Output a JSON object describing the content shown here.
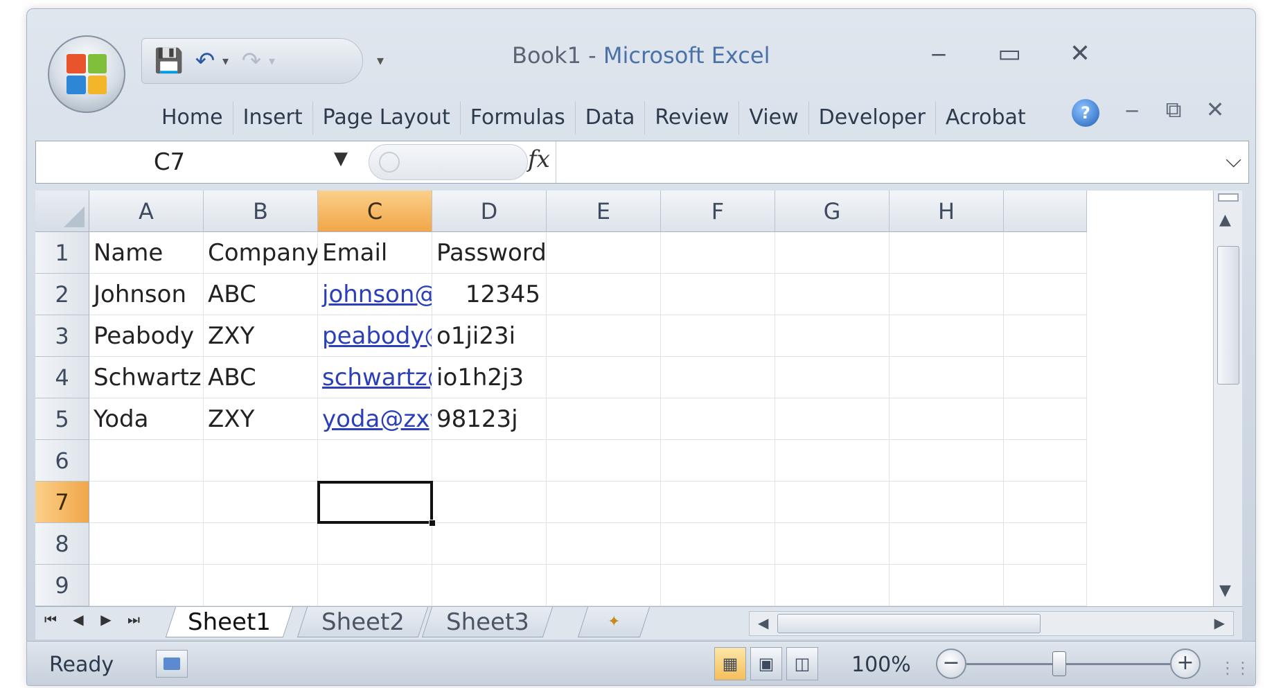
{
  "window": {
    "title_doc": "Book1",
    "title_sep": " - ",
    "title_app": "Microsoft Excel"
  },
  "quick_access": {
    "save_icon": "save-icon",
    "undo_icon": "undo-icon",
    "redo_icon": "redo-icon"
  },
  "ribbon": {
    "tabs": [
      "Home",
      "Insert",
      "Page Layout",
      "Formulas",
      "Data",
      "Review",
      "View",
      "Developer",
      "Acrobat"
    ]
  },
  "formula_bar": {
    "name_box": "C7",
    "fx_label": "fx",
    "formula": ""
  },
  "grid": {
    "columns": [
      "A",
      "B",
      "C",
      "D",
      "E",
      "F",
      "G",
      "H"
    ],
    "rows": [
      "1",
      "2",
      "3",
      "4",
      "5",
      "6",
      "7",
      "8",
      "9"
    ],
    "active_column": "C",
    "active_row": "7",
    "active_cell": "C7",
    "cells": [
      [
        "Name",
        "Company",
        "Email",
        "Password"
      ],
      [
        "Johnson",
        "ABC",
        "johnson@",
        "12345"
      ],
      [
        "Peabody",
        "ZXY",
        "peabody@",
        "o1ji23i"
      ],
      [
        "Schwartz",
        "ABC",
        "schwartz@",
        "io1h2j3"
      ],
      [
        "Yoda",
        "ZXY",
        "yoda@zxy",
        "98123j"
      ]
    ]
  },
  "sheets": {
    "tabs": [
      "Sheet1",
      "Sheet2",
      "Sheet3"
    ],
    "active": "Sheet1"
  },
  "status": {
    "text": "Ready",
    "zoom": "100%",
    "zoom_out": "−",
    "zoom_in": "+"
  },
  "colors": {
    "active_header": "#f1a648",
    "link": "#2a3fb8",
    "chrome": "#cfd8e3"
  }
}
